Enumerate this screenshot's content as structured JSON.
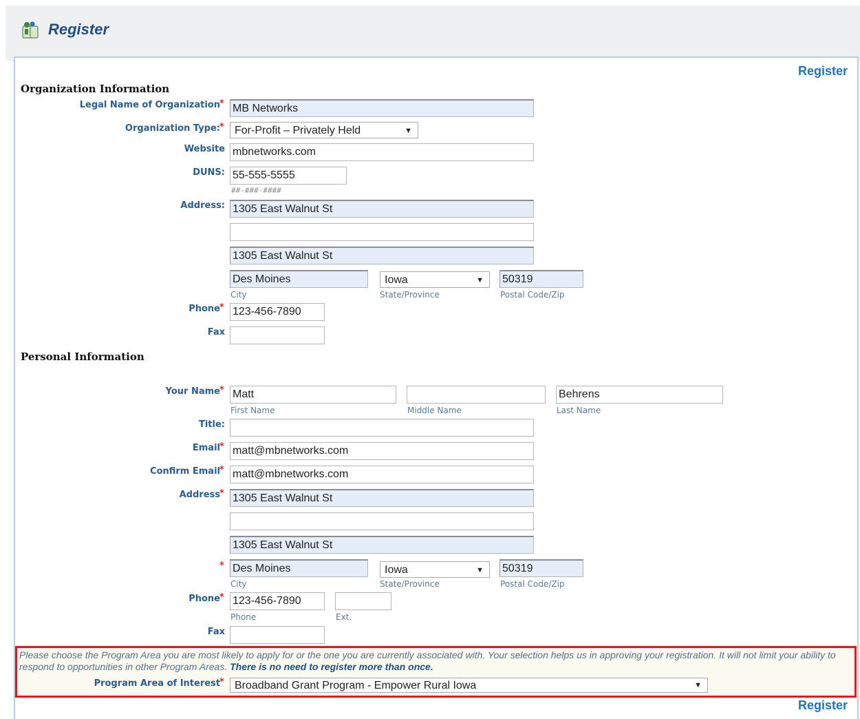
{
  "page": {
    "title": "Register",
    "register_link": "Register"
  },
  "org": {
    "heading": "Organization Information",
    "legal_name": {
      "label": "Legal Name of Organization",
      "value": "MB Networks"
    },
    "org_type": {
      "label": "Organization Type:",
      "value": "For-Profit – Privately Held"
    },
    "website": {
      "label": "Website",
      "value": "mbnetworks.com"
    },
    "duns": {
      "label": "DUNS:",
      "value": "55-555-5555",
      "hint": "##-###-####"
    },
    "address": {
      "label": "Address:",
      "line1": "1305 East Walnut St",
      "line2": "",
      "line3": "1305 East Walnut St",
      "city": "Des Moines",
      "state": "Iowa",
      "zip": "50319",
      "city_label": "City",
      "state_label": "State/Province",
      "zip_label": "Postal Code/Zip"
    },
    "phone": {
      "label": "Phone",
      "value": "123-456-7890"
    },
    "fax": {
      "label": "Fax",
      "value": ""
    }
  },
  "person": {
    "heading": "Personal Information",
    "name": {
      "label": "Your Name",
      "first": "Matt",
      "middle": "",
      "last": "Behrens",
      "first_label": "First Name",
      "middle_label": "Middle Name",
      "last_label": "Last Name"
    },
    "title": {
      "label": "Title:",
      "value": ""
    },
    "email": {
      "label": "Email",
      "value": "matt@mbnetworks.com"
    },
    "confirm_email": {
      "label": "Confirm Email",
      "value": "matt@mbnetworks.com"
    },
    "address": {
      "label": "Address",
      "line1": "1305 East Walnut St",
      "line2": "",
      "line3": "1305 East Walnut St",
      "city": "Des Moines",
      "state": "Iowa",
      "zip": "50319",
      "city_label": "City",
      "state_label": "State/Province",
      "zip_label": "Postal Code/Zip"
    },
    "phone": {
      "label": "Phone",
      "value": "123-456-7890",
      "ext": "",
      "phone_label": "Phone",
      "ext_label": "Ext."
    },
    "fax": {
      "label": "Fax",
      "value": ""
    }
  },
  "program": {
    "note": "Please choose the Program Area you are most likely to apply for or the one you are currently associated with. Your selection helps us in approving your registration. It will not limit your ability to respond to opportunities in other Program Areas. ",
    "note_bold": "There is no need to register more than once.",
    "label": "Program Area of Interest",
    "value": "Broadband Grant Program - Empower Rural Iowa"
  },
  "colors": {
    "accent": "#1f73c3",
    "required": "#e0231d",
    "label": "#2b5c8a",
    "highlight_border": "#e8141b"
  },
  "icons": {
    "app": "book-people-icon",
    "dropdown": "caret-down-icon"
  }
}
